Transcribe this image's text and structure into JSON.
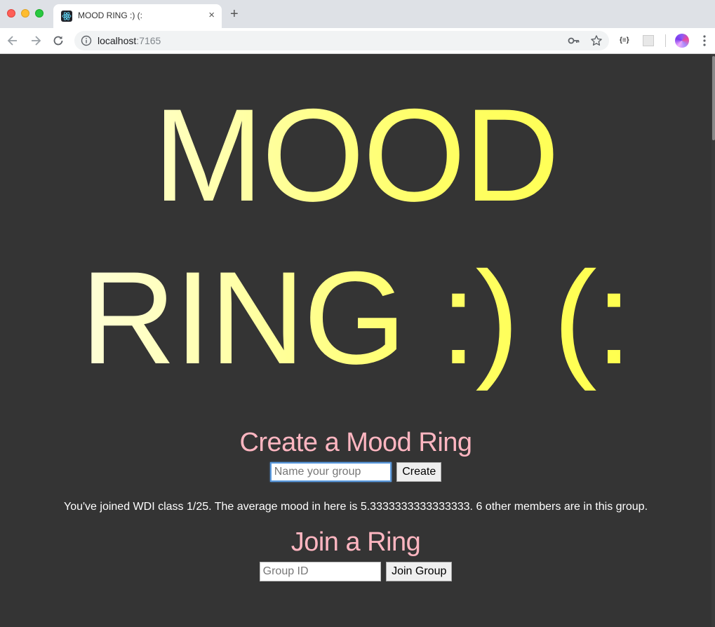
{
  "browser": {
    "tab_title": "MOOD RING :) (:",
    "tab_close": "×",
    "new_tab": "+",
    "url_host": "localhost",
    "url_port": ":7165",
    "ext_json_label": "{≡}"
  },
  "page": {
    "hero_line1": "MOOD",
    "hero_line2": "RING :) (:",
    "create": {
      "title": "Create a Mood Ring",
      "input_placeholder": "Name your group",
      "input_value": "",
      "button_label": "Create"
    },
    "status_text": "You've joined WDI class 1/25. The average mood in here is 5.3333333333333333. 6 other members are in this group.",
    "join": {
      "title": "Join a Ring",
      "input_placeholder": "Group ID",
      "input_value": "",
      "button_label": "Join Group"
    }
  },
  "colors": {
    "background": "#343434",
    "hero_gradient_start": "#fffff0",
    "hero_gradient_end": "#ffff44",
    "section_title": "#ffb6c1",
    "status_text": "#ffffff"
  }
}
